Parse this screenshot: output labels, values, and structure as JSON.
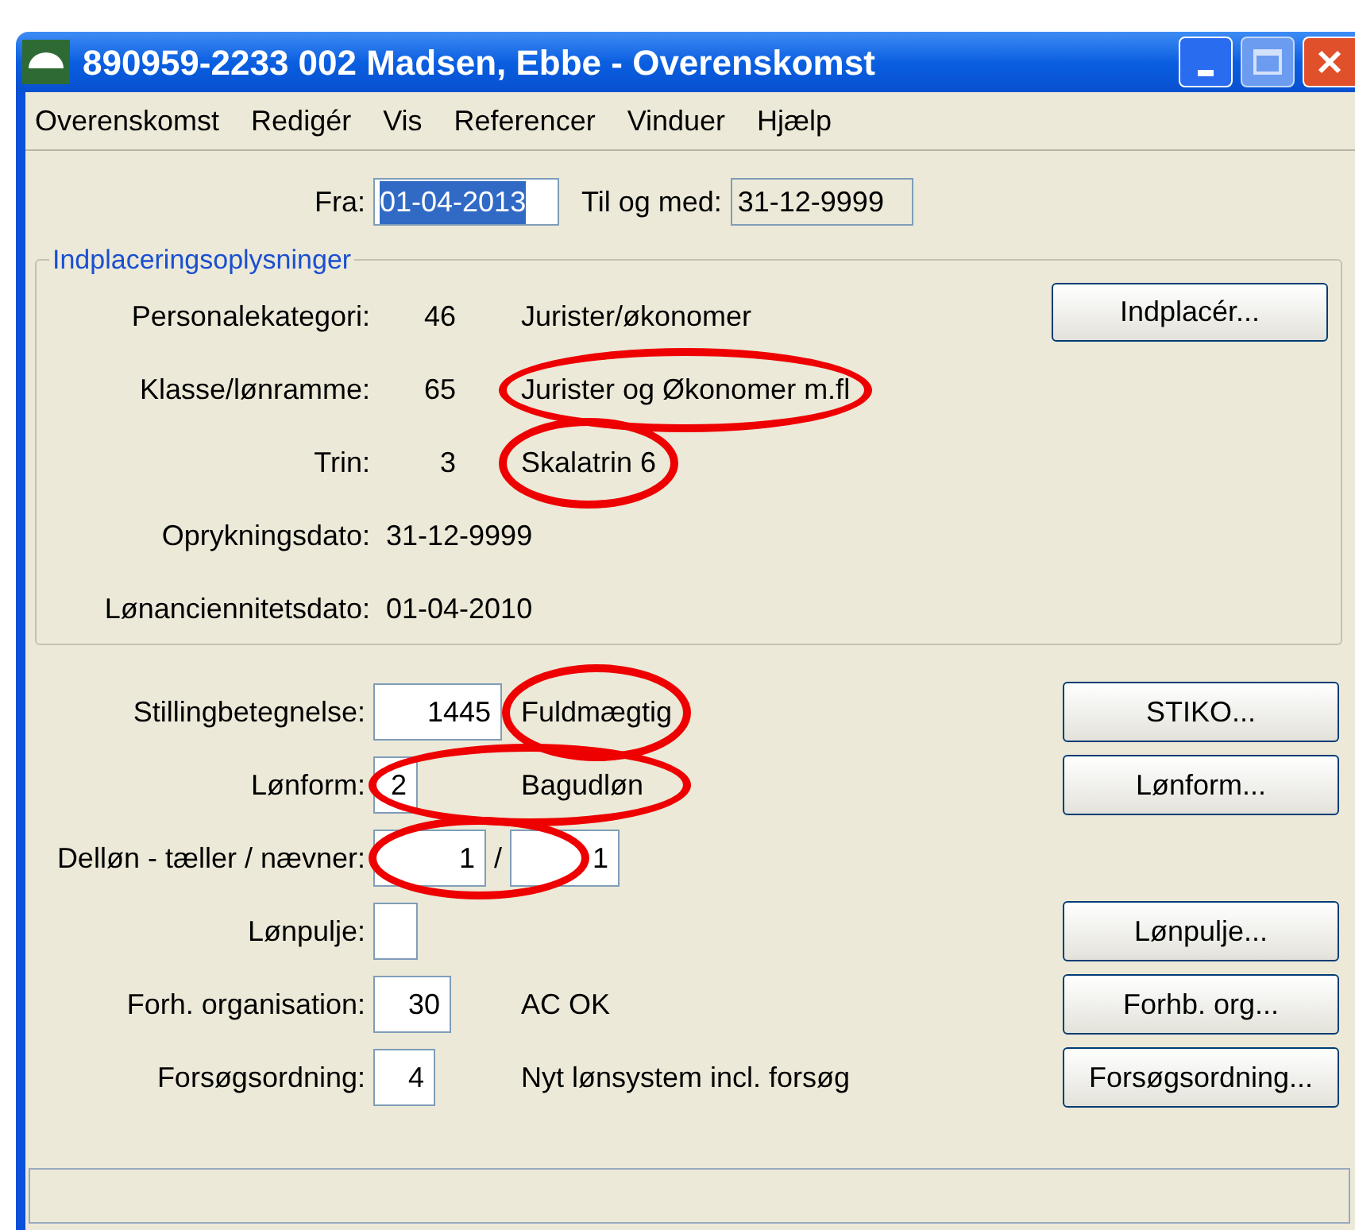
{
  "window": {
    "title": "890959-2233 002 Madsen, Ebbe - Overenskomst"
  },
  "menu": [
    {
      "label": "Overenskomst"
    },
    {
      "label": "Redigér"
    },
    {
      "label": "Vis"
    },
    {
      "label": "Referencer"
    },
    {
      "label": "Vinduer"
    },
    {
      "label": "Hjælp"
    }
  ],
  "period": [
    {
      "label": "Fra:",
      "value": "01-04-2013",
      "text_selected": true,
      "readonly": false
    },
    {
      "label": "Til og med:",
      "value": "31-12-9999",
      "text_selected": false,
      "readonly": true
    }
  ],
  "placement_group": {
    "title": "Indplaceringsoplysninger",
    "rows": [
      {
        "kind": "code",
        "label": "Personalekategori:",
        "code": "46",
        "description": "Jurister/økonomer",
        "circled": false
      },
      {
        "kind": "code",
        "label": "Klasse/lønramme:",
        "code": "65",
        "description": "Jurister og Økonomer m.fl",
        "circled": true
      },
      {
        "kind": "code",
        "label": "Trin:",
        "code": "3",
        "description": "Skalatrin 6",
        "circled": true
      },
      {
        "kind": "date",
        "label": "Oprykningsdato:",
        "value": "31-12-9999",
        "circled": false
      },
      {
        "kind": "date",
        "label": "Lønanciennitetsdato:",
        "value": "01-04-2010",
        "circled": false
      }
    ],
    "button": {
      "label": "Indplacér..."
    }
  },
  "details": [
    {
      "kind": "single",
      "label": "Stillingbetegnelse:",
      "fields": [
        "1445"
      ],
      "description": "Fuldmægtig",
      "circled": true,
      "circle_includes_field": false,
      "button": {
        "label": "STIKO..."
      }
    },
    {
      "kind": "single",
      "label": "Lønform:",
      "fields": [
        "2"
      ],
      "description": "Bagudløn",
      "circled": true,
      "circle_includes_field": true,
      "button": {
        "label": "Lønform..."
      }
    },
    {
      "kind": "fraction",
      "label": "Delløn - tæller / nævner:",
      "fields": [
        "1",
        "1"
      ],
      "separator": "/",
      "circled": true,
      "circle_includes_field": true
    },
    {
      "kind": "single",
      "label": "Lønpulje:",
      "circled": false,
      "button": {
        "label": "Lønpulje..."
      }
    },
    {
      "kind": "single",
      "label": "Forh. organisation:",
      "fields": [
        "30"
      ],
      "description": "AC  OK",
      "circled": false,
      "button": {
        "label": "Forhb. org..."
      }
    },
    {
      "kind": "single",
      "label": "Forsøgsordning:",
      "fields": [
        "4"
      ],
      "description": "Nyt lønsystem incl. forsøg",
      "circled": false,
      "button": {
        "label": "Forsøgsordning..."
      }
    }
  ]
}
